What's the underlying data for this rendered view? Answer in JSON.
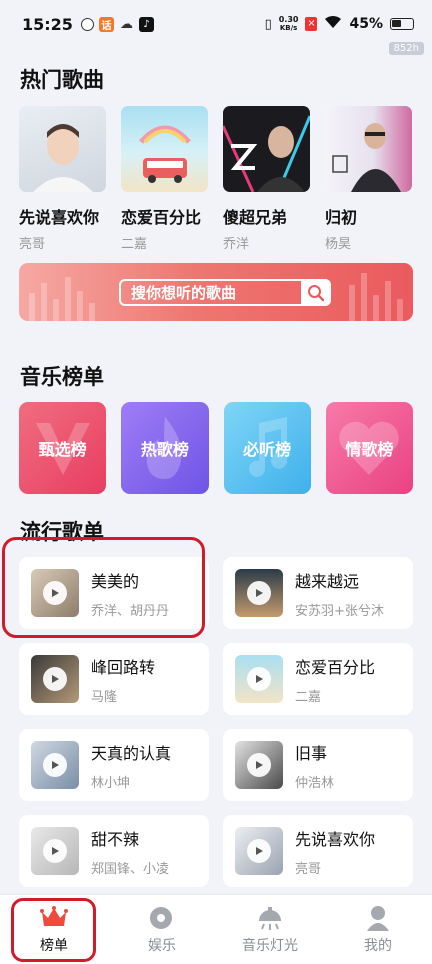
{
  "status_bar": {
    "time": "15:25",
    "net_speed_value": "0.30",
    "net_speed_unit": "KB/s",
    "battery": "45%",
    "fps_tag": "852h"
  },
  "sections": {
    "hot_songs": "热门歌曲",
    "charts": "音乐榜单",
    "playlist": "流行歌单"
  },
  "hot_songs": [
    {
      "title": "先说喜欢你",
      "artist": "亮哥"
    },
    {
      "title": "恋爱百分比",
      "artist": "二嘉"
    },
    {
      "title": "傻超兄弟",
      "artist": "乔洋"
    },
    {
      "title": "归初",
      "artist": "杨昊"
    }
  ],
  "search": {
    "placeholder": "搜你想听的歌曲"
  },
  "charts": [
    {
      "label": "甄选榜",
      "color": "#ef4f6e"
    },
    {
      "label": "热歌榜",
      "color": "#8b6cf0"
    },
    {
      "label": "必听榜",
      "color": "#5cc2f2"
    },
    {
      "label": "情歌榜",
      "color": "#f05590"
    }
  ],
  "playlist": [
    {
      "title": "美美的",
      "artist": "乔洋、胡丹丹"
    },
    {
      "title": "越来越远",
      "artist": "安苏羽+张兮沐"
    },
    {
      "title": "峰回路转",
      "artist": "马隆"
    },
    {
      "title": "恋爱百分比",
      "artist": "二嘉"
    },
    {
      "title": "天真的认真",
      "artist": "林小坤"
    },
    {
      "title": "旧事",
      "artist": "仲浩林"
    },
    {
      "title": "甜不辣",
      "artist": "郑国锋、小凌"
    },
    {
      "title": "先说喜欢你",
      "artist": "亮哥"
    }
  ],
  "tabs": [
    {
      "label": "榜单",
      "icon": "crown-icon",
      "active": true
    },
    {
      "label": "娱乐",
      "icon": "disc-icon",
      "active": false
    },
    {
      "label": "音乐灯光",
      "icon": "lamp-icon",
      "active": false
    },
    {
      "label": "我的",
      "icon": "person-icon",
      "active": false
    }
  ],
  "colors": {
    "accent": "#ea5a5e",
    "tab_active_icon": "#f04a3e",
    "annotation": "#d11a2a"
  }
}
